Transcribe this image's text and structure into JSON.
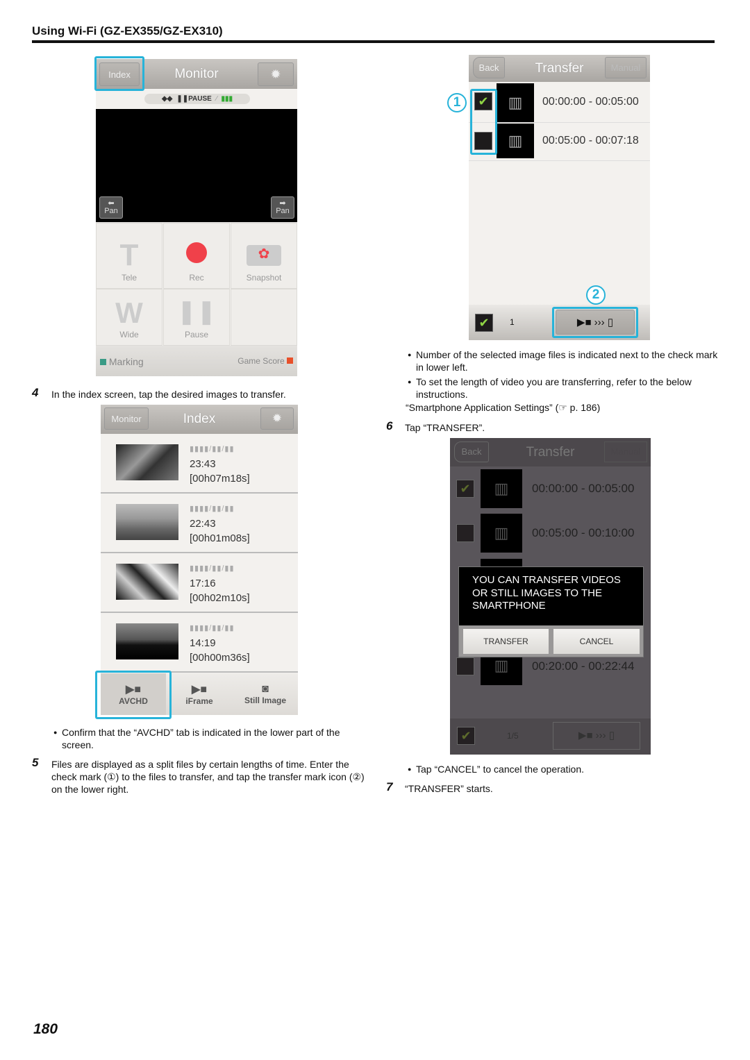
{
  "page_header": "Using Wi-Fi (GZ-EX355/GZ-EX310)",
  "page_number": "180",
  "monitor_screen": {
    "title": "Monitor",
    "index_button": "Index",
    "settings_icon": "gear-icon",
    "status": {
      "pause": "PAUSE"
    },
    "pan_left": "Pan",
    "pan_right": "Pan",
    "tele": "Tele",
    "tele_glyph": "T",
    "rec": "Rec",
    "snapshot": "Snapshot",
    "wide": "Wide",
    "wide_glyph": "W",
    "pause": "Pause",
    "marking": "Marking",
    "game_score": "Game Score",
    "colors": {
      "rec": "#f0414a",
      "marking": "#3a9b86",
      "game_score": "#e8502a",
      "highlight": "#27b3d9"
    }
  },
  "step4": {
    "number": "4",
    "text": "In the index screen, tap the desired images to transfer."
  },
  "index_screen": {
    "title": "Index",
    "monitor_button": "Monitor",
    "items": [
      {
        "date": "▮▮▮▮/▮▮/▮▮",
        "time": "23:43",
        "duration": "[00h07m18s]"
      },
      {
        "date": "▮▮▮▮/▮▮/▮▮",
        "time": "22:43",
        "duration": "[00h01m08s]"
      },
      {
        "date": "▮▮▮▮/▮▮/▮▮",
        "time": "17:16",
        "duration": "[00h02m10s]"
      },
      {
        "date": "▮▮▮▮/▮▮/▮▮",
        "time": "14:19",
        "duration": "[00h00m36s]"
      }
    ],
    "tabs": [
      "AVCHD",
      "iFrame",
      "Still Image"
    ],
    "selected_tab": "AVCHD"
  },
  "note4": "Confirm that the “AVCHD” tab is indicated in the lower part of the screen.",
  "step5": {
    "number": "5",
    "line1": "Files are displayed as a split files by certain lengths of time. Enter the",
    "line2": "check mark (①) to the files to transfer, and tap the transfer mark icon (②)",
    "line3": "on the lower right."
  },
  "transfer_screen": {
    "title": "Transfer",
    "back": "Back",
    "manual": "Manual",
    "rows": [
      {
        "range": "00:00:00 - 00:05:00",
        "checked": true
      },
      {
        "range": "00:05:00 - 00:07:18",
        "checked": false
      }
    ],
    "count": "1",
    "callout1": "1",
    "callout2": "2"
  },
  "notes5": [
    "Number of the selected image files is indicated next to the check mark in lower left.",
    "To set the length of video you are transferring, refer to the below instructions."
  ],
  "reference": "“Smartphone Application Settings” (☞ p. 186)",
  "step6": {
    "number": "6",
    "text": "Tap “TRANSFER”."
  },
  "transfer_dialog_screen": {
    "title": "Transfer",
    "back": "Back",
    "manual": "Manual",
    "rows": [
      {
        "range": "00:00:00 - 00:05:00",
        "checked": true
      },
      {
        "range": "00:05:00 - 00:10:00",
        "checked": false
      },
      {
        "range": "00:20:00 - 00:22:44",
        "checked": false
      }
    ],
    "count": "1/5",
    "dialog": {
      "line1": "YOU CAN TRANSFER VIDEOS",
      "line2": "OR STILL IMAGES TO THE",
      "line3": "SMARTPHONE",
      "transfer": "TRANSFER",
      "cancel": "CANCEL"
    }
  },
  "note6": "Tap “CANCEL” to cancel the operation.",
  "step7": {
    "number": "7",
    "text": "“TRANSFER” starts."
  }
}
